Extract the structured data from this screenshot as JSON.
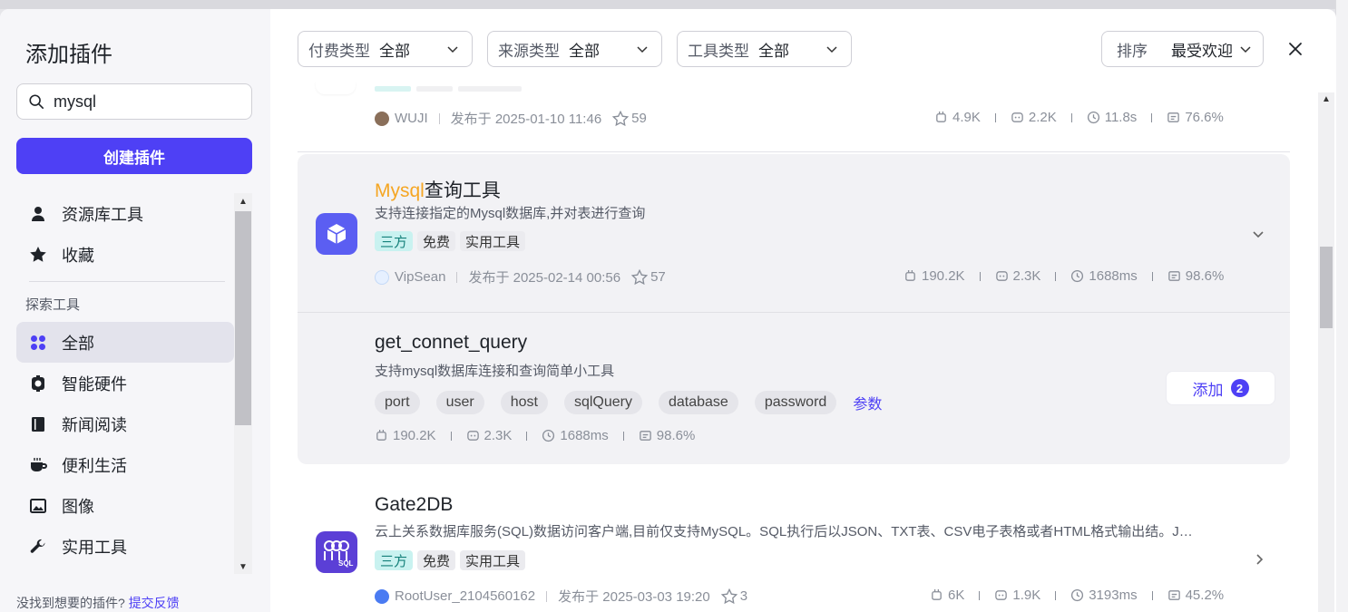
{
  "sidebar": {
    "title": "添加插件",
    "search": {
      "value": "mysql",
      "placeholder": ""
    },
    "create_label": "创建插件",
    "top_items": [
      {
        "label": "资源库工具",
        "icon": "user-icon"
      },
      {
        "label": "收藏",
        "icon": "star-icon"
      }
    ],
    "section_label": "探索工具",
    "items": [
      {
        "label": "全部",
        "icon": "grid-icon",
        "active": true
      },
      {
        "label": "智能硬件",
        "icon": "chip-icon"
      },
      {
        "label": "新闻阅读",
        "icon": "book-icon"
      },
      {
        "label": "便利生活",
        "icon": "coffee-icon"
      },
      {
        "label": "图像",
        "icon": "image-icon"
      },
      {
        "label": "实用工具",
        "icon": "wrench-icon"
      }
    ],
    "footer_text": "没找到想要的插件?",
    "footer_link": "提交反馈"
  },
  "filters": [
    {
      "label": "付费类型",
      "value": "全部"
    },
    {
      "label": "来源类型",
      "value": "全部"
    },
    {
      "label": "工具类型",
      "value": "全部"
    }
  ],
  "sort": {
    "label": "排序",
    "value": "最受欢迎"
  },
  "plugins": [
    {
      "author": "WUJI",
      "published": "发布于 2025-01-10 11:46",
      "stars": "59",
      "stats": {
        "calls": "4.9K",
        "bots": "2.2K",
        "latency": "11.8s",
        "success": "76.6%"
      }
    },
    {
      "name_highlight": "Mysql",
      "name_rest": "查询工具",
      "description": "支持连接指定的Mysql数据库,并对表进行查询",
      "tags": [
        "三方",
        "免费",
        "实用工具"
      ],
      "author": "VipSean",
      "published": "发布于 2025-02-14 00:56",
      "stars": "57",
      "stats": {
        "calls": "190.2K",
        "bots": "2.3K",
        "latency": "1688ms",
        "success": "98.6%"
      }
    },
    {
      "tool_name": "get_connet_query",
      "tool_description": "支持mysql数据库连接和查询简单小工具",
      "params": [
        "port",
        "user",
        "host",
        "sqlQuery",
        "database",
        "password"
      ],
      "params_link": "参数",
      "stats": {
        "calls": "190.2K",
        "bots": "2.3K",
        "latency": "1688ms",
        "success": "98.6%"
      },
      "add_label": "添加",
      "add_count": "2"
    },
    {
      "name": "Gate2DB",
      "description": "云上关系数据库服务(SQL)数据访问客户端,目前仅支持MySQL。SQL执行后以JSON、TXT表、CSV电子表格或者HTML格式输出结。J…",
      "tags": [
        "三方",
        "免费",
        "实用工具"
      ],
      "author": "RootUser_2104560162",
      "published": "发布于 2025-03-03 19:20",
      "stars": "3",
      "stats": {
        "calls": "6K",
        "bots": "1.9K",
        "latency": "3193ms",
        "success": "45.2%"
      }
    }
  ],
  "colors": {
    "accent": "#4e40f5",
    "highlight": "#f5a623",
    "tag_third_bg": "#c9f2f0"
  }
}
